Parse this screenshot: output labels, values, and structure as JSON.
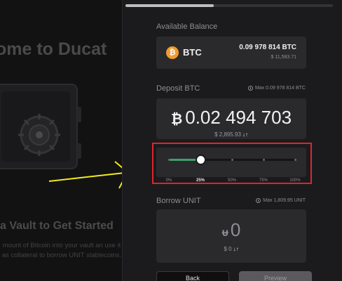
{
  "background": {
    "welcome_title": "ome to Ducat",
    "vault_subtitle": "a Vault to Get Started",
    "vault_description": "mount of Bitcoin into your vault an use it as collateral to borrow UNIT stablecoins."
  },
  "balance": {
    "label": "Available Balance",
    "asset_symbol": "BTC",
    "icon_glyph": "₿",
    "amount": "0.09 978 814 BTC",
    "usd": "$ 11,583.71"
  },
  "deposit": {
    "label": "Deposit BTC",
    "max": "Max 0.09 978 814 BTC",
    "symbol": "₿",
    "value": "0.02 494 703",
    "usd": "$ 2,895.93",
    "swap_glyph": "↓↑"
  },
  "slider": {
    "value_fraction": 0.25,
    "ticks": [
      "0%",
      "25%",
      "50%",
      "75%",
      "100%"
    ],
    "active_tick": "25%",
    "colors": {
      "fill": "#3fa16a",
      "highlight": "#e0242c"
    }
  },
  "borrow": {
    "label": "Borrow UNIT",
    "max": "Max 1,809.95 UNIT",
    "symbol": "ᵾ",
    "value": "0",
    "usd": "$ 0",
    "swap_glyph": "↓↑"
  },
  "buttons": {
    "back": "Back",
    "preview": "Preview"
  }
}
